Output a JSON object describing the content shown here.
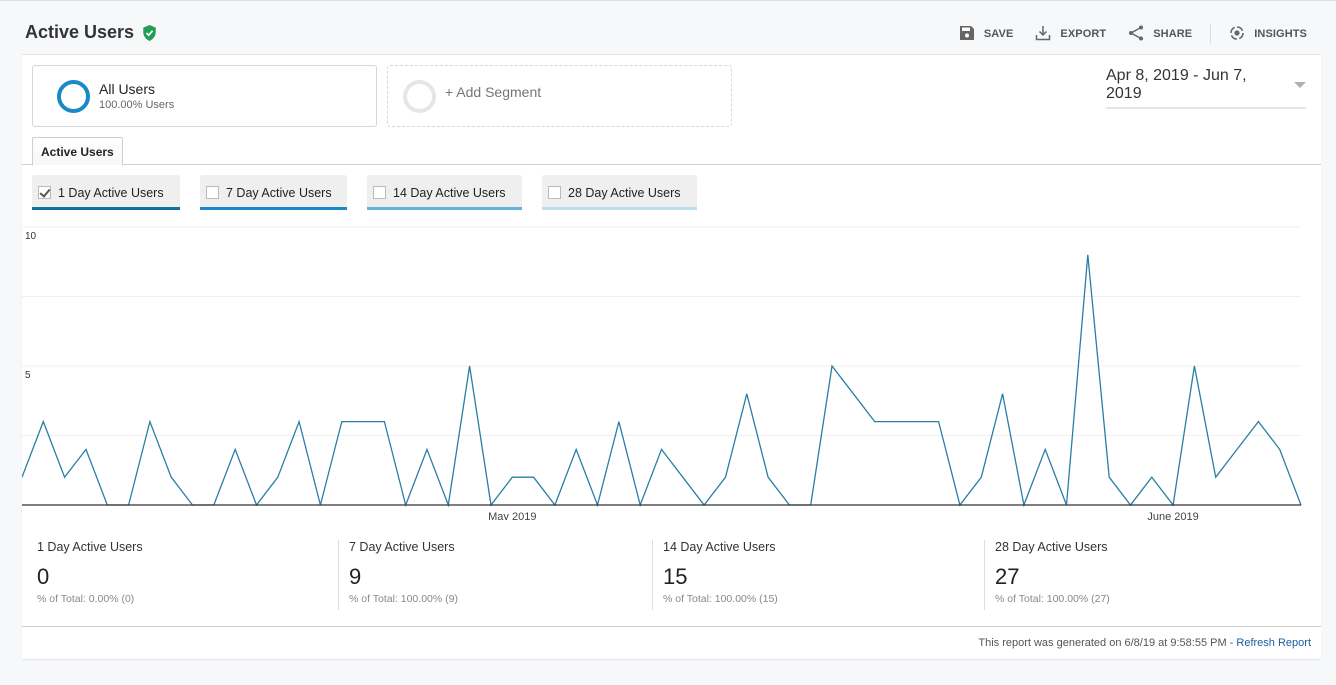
{
  "header": {
    "title": "Active Users",
    "verified_icon": "shield-check-icon",
    "toolbar": [
      {
        "label": "SAVE",
        "icon": "save-icon"
      },
      {
        "label": "EXPORT",
        "icon": "download-icon"
      },
      {
        "label": "SHARE",
        "icon": "share-icon"
      },
      {
        "label": "INSIGHTS",
        "icon": "insights-icon"
      }
    ]
  },
  "segments": {
    "active": {
      "name": "All Users",
      "sub": "100.00% Users"
    },
    "add_label": "+ Add Segment"
  },
  "date_range": "Apr 8, 2019 - Jun 7, 2019",
  "tabs": [
    {
      "label": "Active Users"
    }
  ],
  "metric_pills": [
    {
      "label": "1 Day Active Users",
      "checked": true,
      "color": "#15719c"
    },
    {
      "label": "7 Day Active Users",
      "checked": false,
      "color": "#1a8ac6"
    },
    {
      "label": "14 Day Active Users",
      "checked": false,
      "color": "#63b3da"
    },
    {
      "label": "28 Day Active Users",
      "checked": false,
      "color": "#bcdff0"
    }
  ],
  "chart_data": {
    "type": "line",
    "title": "",
    "xlabel": "",
    "ylabel": "",
    "series": [
      {
        "name": "1 Day Active Users",
        "color": "#2a7ea6",
        "values": [
          1,
          3,
          1,
          2,
          0,
          0,
          3,
          1,
          0,
          0,
          2,
          0,
          1,
          3,
          0,
          3,
          3,
          3,
          0,
          2,
          0,
          5,
          0,
          1,
          1,
          0,
          2,
          0,
          3,
          0,
          2,
          1,
          0,
          1,
          4,
          1,
          0,
          0,
          5,
          4,
          3,
          3,
          3,
          3,
          0,
          1,
          4,
          0,
          2,
          0,
          9,
          1,
          0,
          1,
          0,
          5,
          1,
          2,
          3,
          2,
          0
        ]
      }
    ],
    "x_start": "2019-04-08",
    "x_end": "2019-06-07",
    "x_ticks": [
      {
        "index": 23,
        "label": "May 2019"
      },
      {
        "index": 54,
        "label": "June 2019"
      }
    ],
    "y_ticks": [
      {
        "value": 10,
        "label": "10"
      },
      {
        "value": 5,
        "label": "5"
      }
    ],
    "ylim": [
      0,
      10
    ],
    "grid": true
  },
  "scorecards": [
    {
      "label": "1 Day Active Users",
      "value": "0",
      "sub": "% of Total: 0.00% (0)"
    },
    {
      "label": "7 Day Active Users",
      "value": "9",
      "sub": "% of Total: 100.00% (9)"
    },
    {
      "label": "14 Day Active Users",
      "value": "15",
      "sub": "% of Total: 100.00% (15)"
    },
    {
      "label": "28 Day Active Users",
      "value": "27",
      "sub": "% of Total: 100.00% (27)"
    }
  ],
  "footer": {
    "text": "This report was generated on 6/8/19 at 9:58:55 PM - ",
    "link": "Refresh Report"
  }
}
